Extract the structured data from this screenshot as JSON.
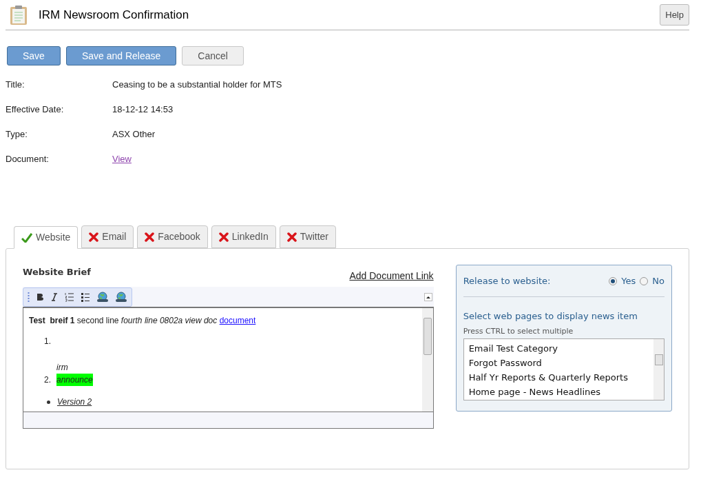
{
  "header": {
    "title": "IRM Newsroom Confirmation",
    "help": "Help"
  },
  "actions": [
    {
      "label": "Save",
      "kind": "primary"
    },
    {
      "label": "Save and Release",
      "kind": "primary"
    },
    {
      "label": "Cancel",
      "kind": "secondary"
    }
  ],
  "details": [
    {
      "label": "Title:",
      "value": "Ceasing to be a substantial holder for MTS",
      "kind": "text"
    },
    {
      "label": "Effective Date:",
      "value": "18-12-12 14:53",
      "kind": "text"
    },
    {
      "label": "Type:",
      "value": "ASX Other",
      "kind": "text"
    },
    {
      "label": "Document:",
      "value": "View",
      "kind": "link"
    }
  ],
  "tabs": [
    {
      "label": "Website",
      "kind": "ok",
      "selected": true
    },
    {
      "label": "Email",
      "kind": "error",
      "selected": false
    },
    {
      "label": "Facebook",
      "kind": "error",
      "selected": false
    },
    {
      "label": "LinkedIn",
      "kind": "error",
      "selected": false
    },
    {
      "label": "Twitter",
      "kind": "error",
      "selected": false
    }
  ],
  "brief": {
    "title": "Website Brief",
    "add_link": "Add Document Link",
    "intro": "**Test  breif 1** second line *fourth line 0802a view doc*",
    "intro_link": "document",
    "ordered_list": [
      {
        "marker": "1."
      },
      {
        "marker": "2.",
        "note": "irm",
        "text": "announce",
        "color": "#00ff00"
      }
    ],
    "bullet_list": [
      {
        "text": "Version 2"
      }
    ]
  },
  "release": {
    "label": "Release to website:",
    "options": [
      {
        "label": "Yes",
        "selected": true
      },
      {
        "label": "No",
        "selected": false
      }
    ],
    "pages_title": "Select web pages to display news item",
    "hint": "Press CTRL to select multiple",
    "pages": [
      {
        "label": "Email Test Category",
        "selected": false
      },
      {
        "label": "Forgot Password",
        "selected": false
      },
      {
        "label": "Half Yr Reports & Quarterly Reports",
        "selected": false
      },
      {
        "label": "Home page - News Headlines",
        "selected": false
      }
    ]
  }
}
